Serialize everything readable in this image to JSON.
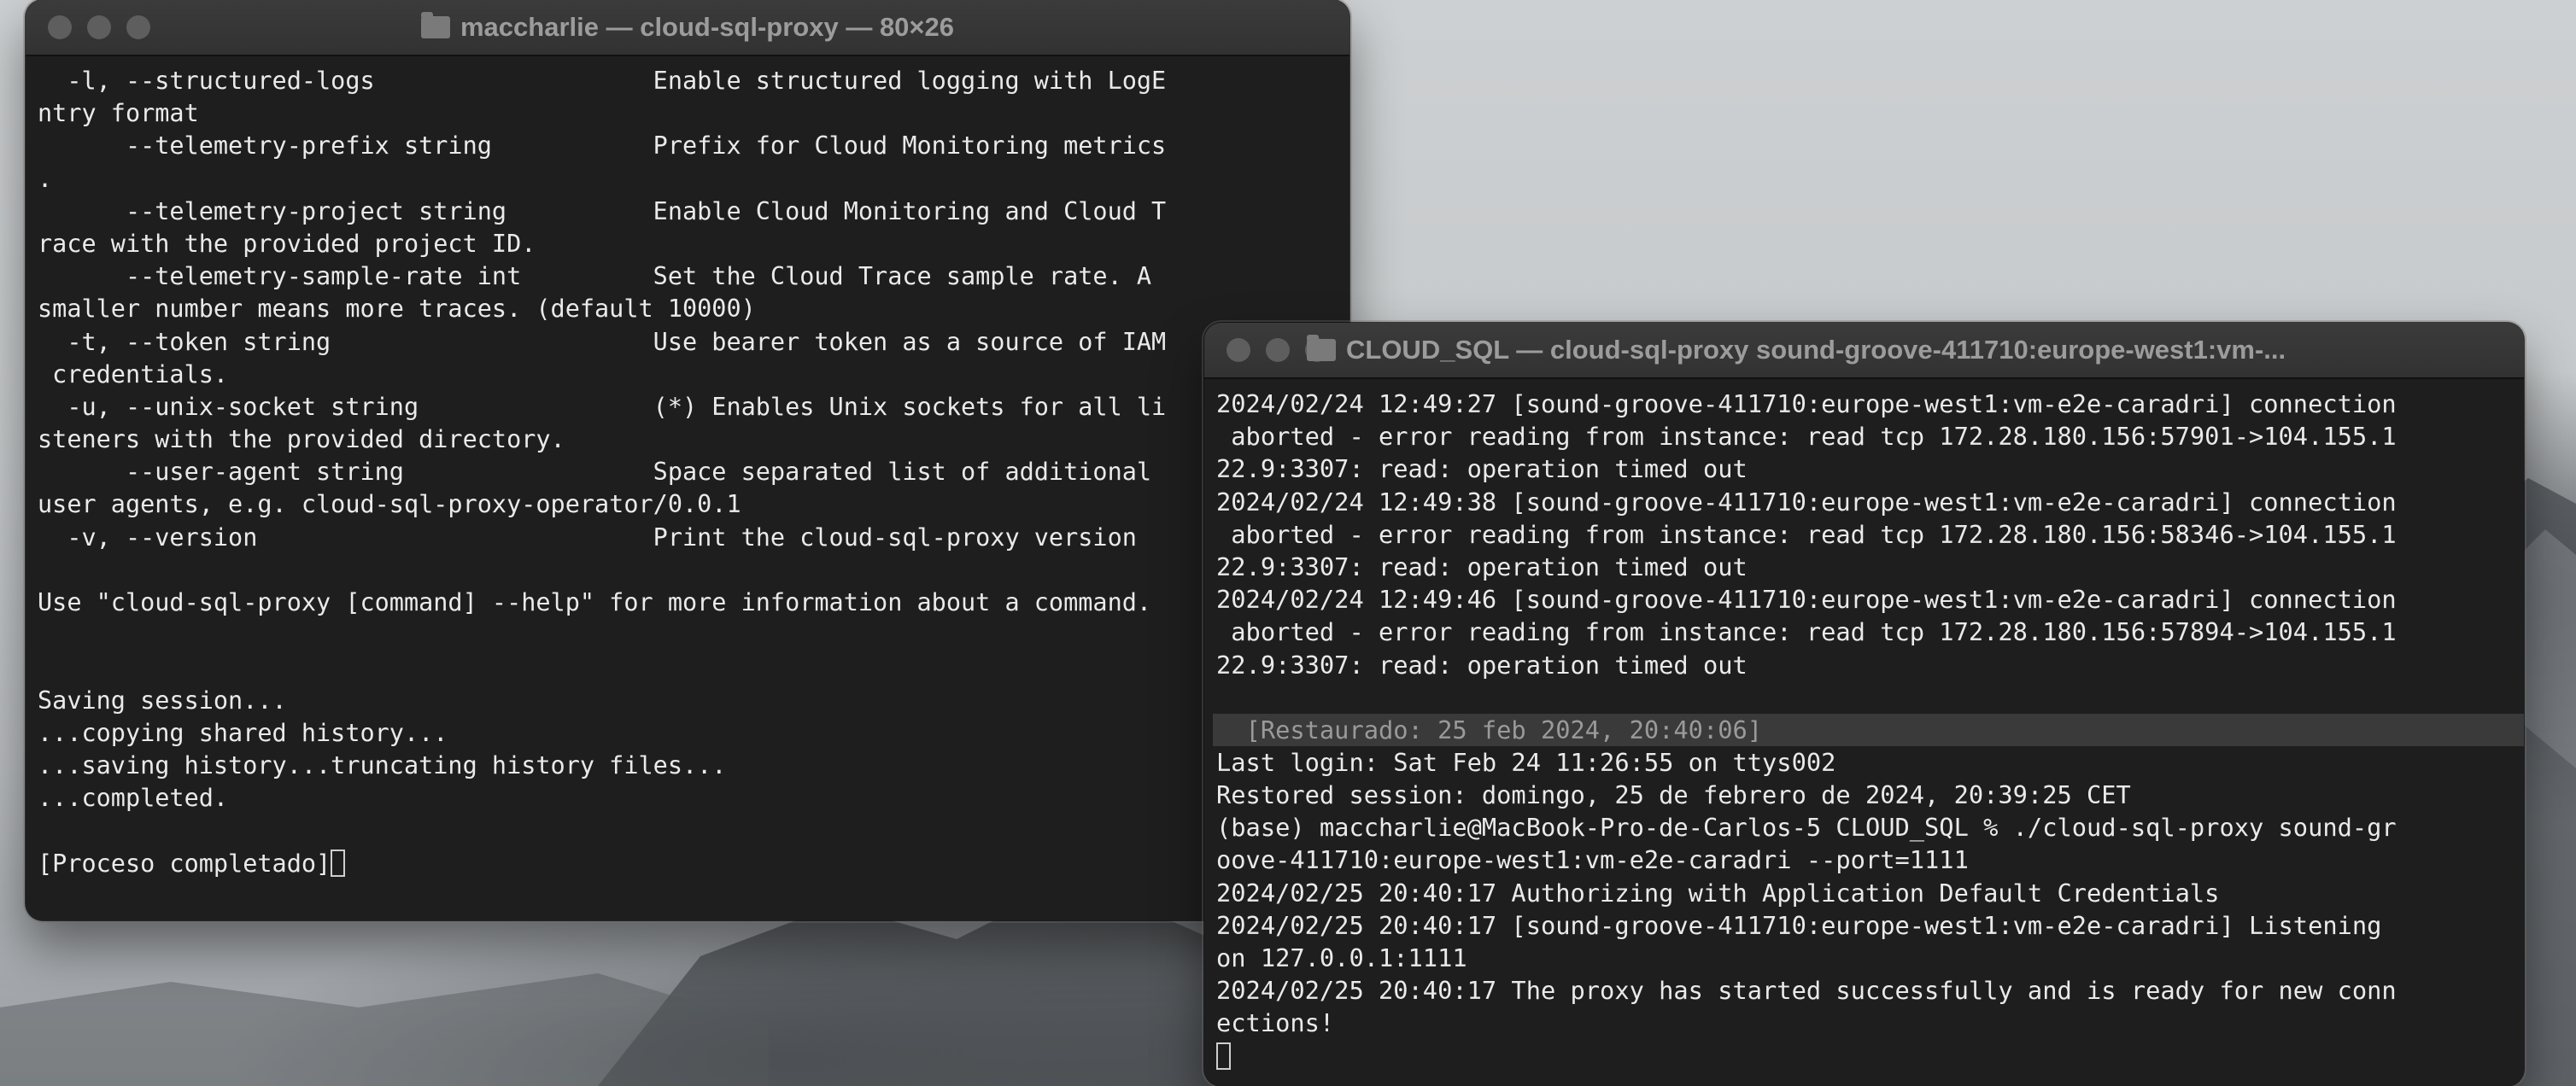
{
  "left_window": {
    "title": "maccharlie — cloud-sql-proxy — 80×26",
    "lines": [
      "  -l, --structured-logs                   Enable structured logging with LogE",
      "ntry format",
      "      --telemetry-prefix string           Prefix for Cloud Monitoring metrics",
      ".",
      "      --telemetry-project string          Enable Cloud Monitoring and Cloud T",
      "race with the provided project ID.",
      "      --telemetry-sample-rate int         Set the Cloud Trace sample rate. A",
      "smaller number means more traces. (default 10000)",
      "  -t, --token string                      Use bearer token as a source of IAM",
      " credentials.",
      "  -u, --unix-socket string                (*) Enables Unix sockets for all li",
      "steners with the provided directory.",
      "      --user-agent string                 Space separated list of additional",
      "user agents, e.g. cloud-sql-proxy-operator/0.0.1",
      "  -v, --version                           Print the cloud-sql-proxy version",
      "",
      "Use \"cloud-sql-proxy [command] --help\" for more information about a command.",
      "",
      "",
      "Saving session...",
      "...copying shared history...",
      "...saving history...truncating history files...",
      "...completed.",
      ""
    ],
    "final_line": "[Proceso completado]"
  },
  "right_window": {
    "title": "CLOUD_SQL — cloud-sql-proxy sound-groove-411710:europe-west1:vm-...",
    "lines_before": [
      "2024/02/24 12:49:27 [sound-groove-411710:europe-west1:vm-e2e-caradri] connection",
      " aborted - error reading from instance: read tcp 172.28.180.156:57901->104.155.1",
      "22.9:3307: read: operation timed out",
      "2024/02/24 12:49:38 [sound-groove-411710:europe-west1:vm-e2e-caradri] connection",
      " aborted - error reading from instance: read tcp 172.28.180.156:58346->104.155.1",
      "22.9:3307: read: operation timed out",
      "2024/02/24 12:49:46 [sound-groove-411710:europe-west1:vm-e2e-caradri] connection",
      " aborted - error reading from instance: read tcp 172.28.180.156:57894->104.155.1",
      "22.9:3307: read: operation timed out",
      ""
    ],
    "restore_banner": "  [Restaurado: 25 feb 2024, 20:40:06]",
    "lines_after": [
      "Last login: Sat Feb 24 11:26:55 on ttys002",
      "Restored session: domingo, 25 de febrero de 2024, 20:39:25 CET",
      "(base) maccharlie@MacBook-Pro-de-Carlos-5 CLOUD_SQL % ./cloud-sql-proxy sound-gr",
      "oove-411710:europe-west1:vm-e2e-caradri --port=1111",
      "2024/02/25 20:40:17 Authorizing with Application Default Credentials",
      "2024/02/25 20:40:17 [sound-groove-411710:europe-west1:vm-e2e-caradri] Listening",
      "on 127.0.0.1:1111",
      "2024/02/25 20:40:17 The proxy has started successfully and is ready for new conn",
      "ections!"
    ]
  }
}
